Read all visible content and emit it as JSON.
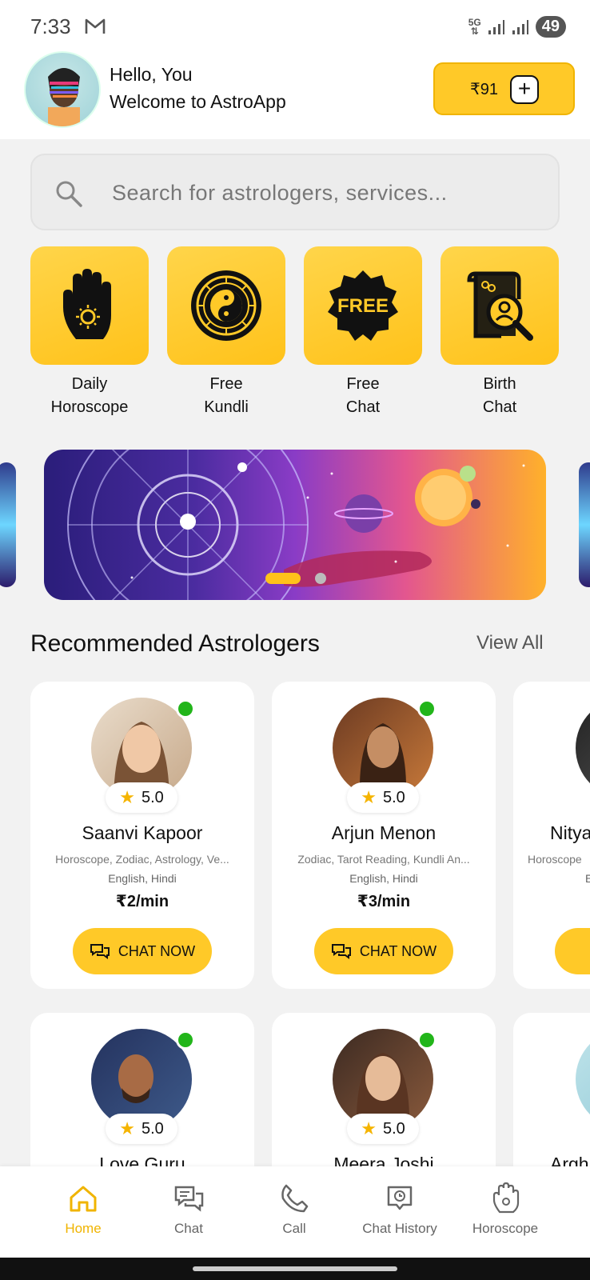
{
  "status_bar": {
    "time": "7:33",
    "network": "5G",
    "battery": "49"
  },
  "header": {
    "greeting": "Hello, You",
    "welcome": "Welcome to AstroApp",
    "wallet_amount": "₹91",
    "wallet_add": "+"
  },
  "search": {
    "placeholder": "Search for astrologers, services..."
  },
  "quick_actions": [
    {
      "line1": "Daily",
      "line2": "Horoscope",
      "icon": "palm-icon"
    },
    {
      "line1": "Free",
      "line2": "Kundli",
      "icon": "yin-yang-icon"
    },
    {
      "line1": "Free",
      "line2": "Chat",
      "icon": "free-badge-icon",
      "badge_text": "FREE"
    },
    {
      "line1": "Birth",
      "line2": "Chat",
      "icon": "scroll-search-icon"
    }
  ],
  "banner": {
    "active_slide": 1,
    "slide_count": 2
  },
  "recommended": {
    "title": "Recommended Astrologers",
    "view_all": "View All"
  },
  "astrologers": [
    {
      "name": "Saanvi Kapoor",
      "rating": "5.0",
      "skills": "Horoscope, Zodiac, Astrology, Ve...",
      "languages": "English, Hindi",
      "price": "₹2/min",
      "cta": "CHAT NOW"
    },
    {
      "name": "Arjun Menon",
      "rating": "5.0",
      "skills": "Zodiac, Tarot Reading, Kundli An...",
      "languages": "English, Hindi",
      "price": "₹3/min",
      "cta": "CHAT NOW"
    },
    {
      "name": "Nitya",
      "skills": "Horoscope",
      "languages": "E"
    },
    {
      "name": "Love Guru",
      "rating": "5.0"
    },
    {
      "name": "Meera Joshi",
      "rating": "5.0"
    },
    {
      "name": "Argh"
    }
  ],
  "nav": {
    "home": "Home",
    "chat": "Chat",
    "call": "Call",
    "history": "Chat History",
    "horoscope": "Horoscope"
  },
  "colors": {
    "accent": "#ffc928",
    "online": "#22b51a",
    "active_nav": "#f0b400"
  }
}
